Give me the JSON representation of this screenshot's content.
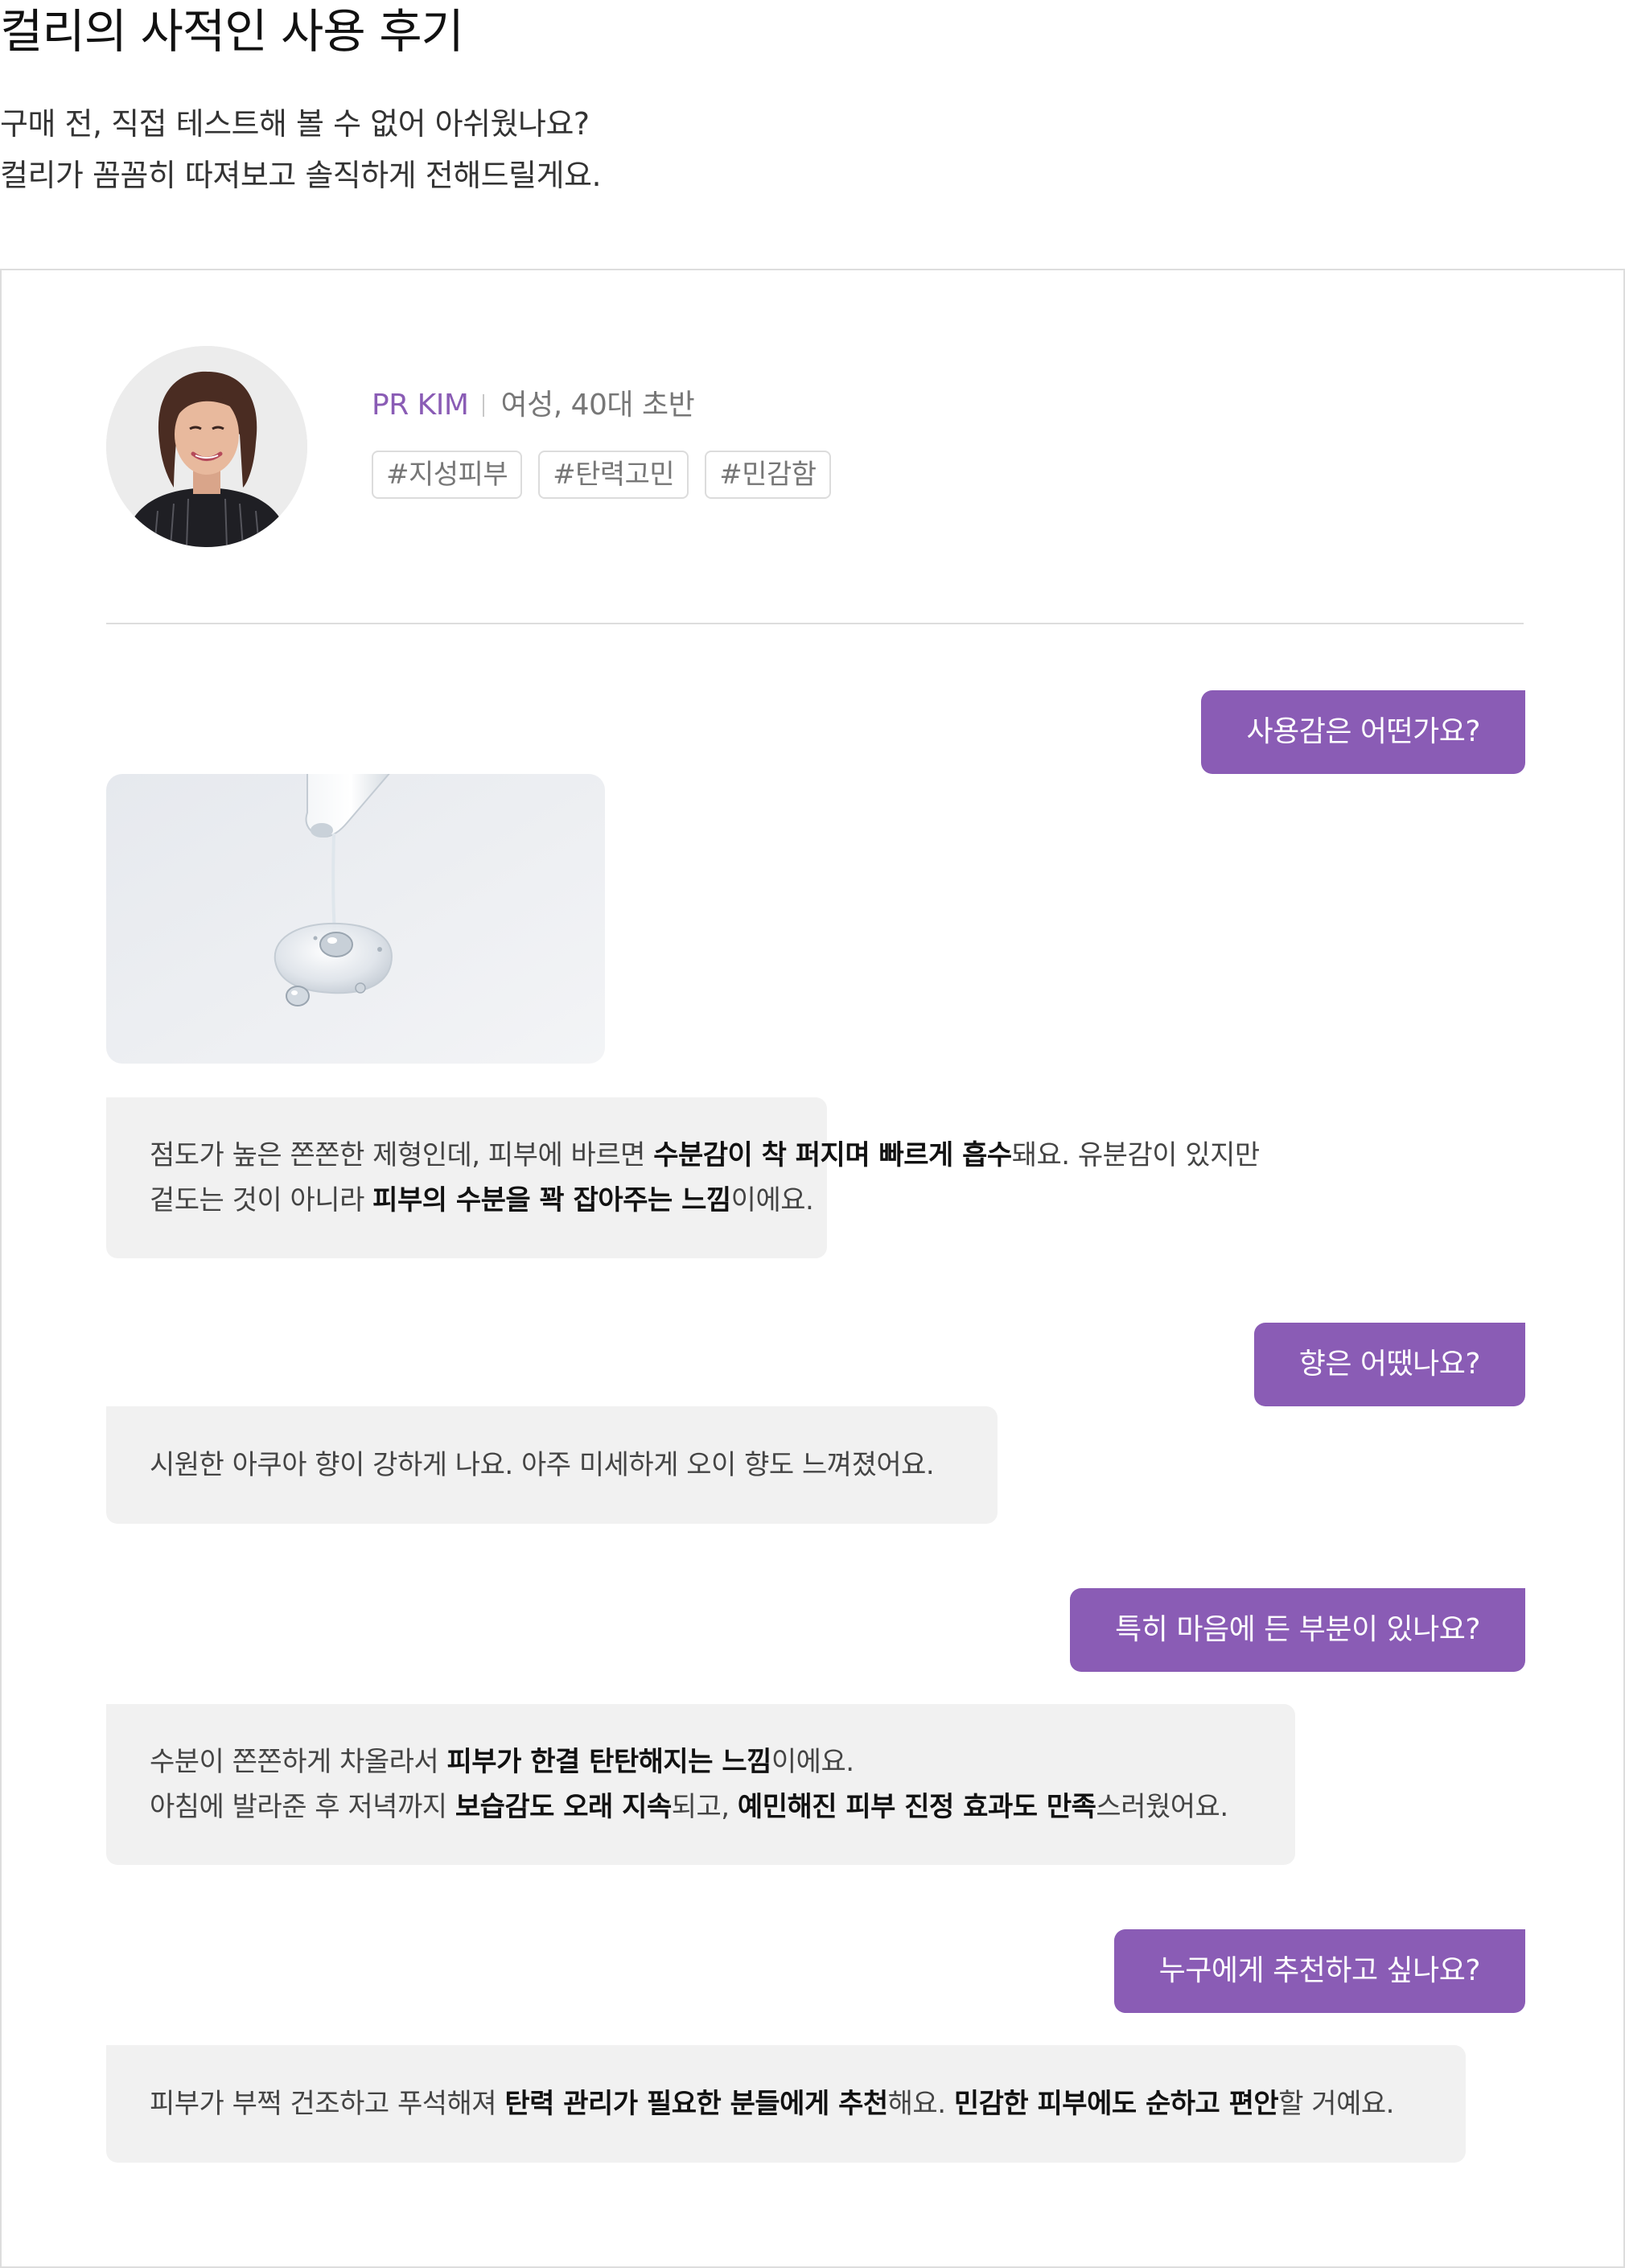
{
  "title": "컬리의 사적인 사용 후기",
  "intro": {
    "line1": "구매 전, 직접 테스트해 볼 수 없어 아쉬웠나요?",
    "line2": "컬리가 꼼꼼히 따져보고 솔직하게 전해드릴게요."
  },
  "reviewer": {
    "name": "PR KIM",
    "meta": "여성, 40대 초반",
    "tags": [
      "#지성피부",
      "#탄력고민",
      "#민감함"
    ]
  },
  "colors": {
    "accent": "#8a5cb5",
    "answer_background": "#f1f1f1",
    "border": "#dddddd"
  },
  "qa": [
    {
      "question": "사용감은 어떤가요?",
      "answer": [
        [
          {
            "t": "점도가 높은 쫀쫀한 제형인데, 피부에 바르면 ",
            "b": false
          },
          {
            "t": "수분감이 착 퍼지며 빠르게 흡수",
            "b": true
          },
          {
            "t": "돼요. 유분감이 있지만",
            "b": false
          }
        ],
        [
          {
            "t": "겉도는 것이 아니라 ",
            "b": false
          },
          {
            "t": "피부의 수분을 꽉 잡아주는 느낌",
            "b": true
          },
          {
            "t": "이에요.",
            "b": false
          }
        ]
      ]
    },
    {
      "question": "향은 어땠나요?",
      "answer": [
        [
          {
            "t": "시원한 아쿠아 향이 강하게 나요. 아주 미세하게 오이 향도 느껴졌어요.",
            "b": false
          }
        ]
      ]
    },
    {
      "question": "특히 마음에 든 부분이 있나요?",
      "answer": [
        [
          {
            "t": "수분이 쫀쫀하게 차올라서 ",
            "b": false
          },
          {
            "t": "피부가 한결 탄탄해지는 느낌",
            "b": true
          },
          {
            "t": "이에요.",
            "b": false
          }
        ],
        [
          {
            "t": "아침에 발라준 후 저녁까지 ",
            "b": false
          },
          {
            "t": "보습감도 오래 지속",
            "b": true
          },
          {
            "t": "되고, ",
            "b": false
          },
          {
            "t": "예민해진 피부 진정 효과도 만족",
            "b": true
          },
          {
            "t": "스러웠어요.",
            "b": false
          }
        ]
      ]
    },
    {
      "question": "누구에게 추천하고 싶나요?",
      "answer": [
        [
          {
            "t": "피부가 부쩍 건조하고 푸석해져 ",
            "b": false
          },
          {
            "t": "탄력 관리가 필요한 분들에게 추천",
            "b": true
          },
          {
            "t": "해요. ",
            "b": false
          },
          {
            "t": "민감한 피부에도 순하고 편안",
            "b": true
          },
          {
            "t": "할 거예요.",
            "b": false
          }
        ]
      ]
    }
  ]
}
